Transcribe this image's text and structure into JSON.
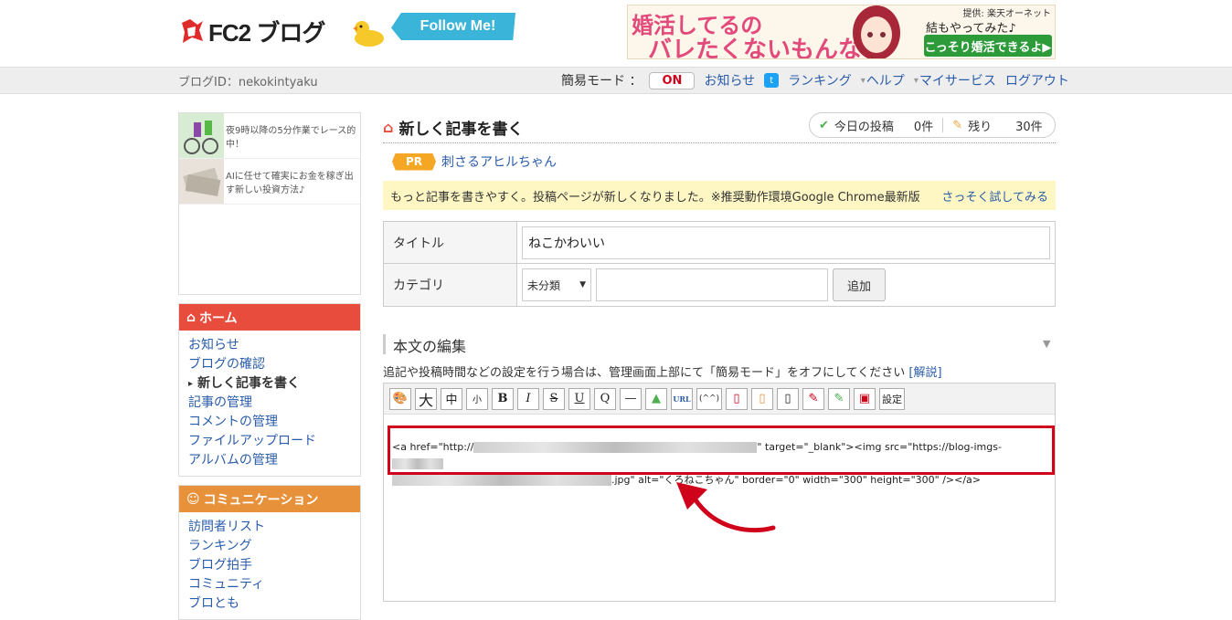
{
  "header": {
    "logo_text": "FC2 ブログ",
    "follow_label": "Follow Me!",
    "ad": {
      "headline1": "婚活してるの",
      "headline2": "バレたくないもんな",
      "provider": "提供: 楽天オーネット",
      "tagline": "結もやってみた♪",
      "button": "こっそり婚活できるよ▶"
    }
  },
  "navbar": {
    "blog_id": "ブログID：nekokintyaku",
    "mode_label": "簡易モード ：",
    "mode_toggle": "ON",
    "links": [
      "お知らせ",
      "ランキング",
      "ヘルプ",
      "マイサービス",
      "ログアウト"
    ]
  },
  "sidebar": {
    "ads": [
      {
        "text": "夜9時以降の5分作業でレース的中！"
      },
      {
        "text": "AIに任せて確実にお金を稼ぎ出す新しい投資方法♪"
      }
    ],
    "home": {
      "title": "ホーム",
      "items": [
        "お知らせ",
        "ブログの確認",
        "新しく記事を書く",
        "記事の管理",
        "コメントの管理",
        "ファイルアップロード",
        "アルバムの管理"
      ]
    },
    "communication": {
      "title": "コミュニケーション",
      "items": [
        "訪問者リスト",
        "ランキング",
        "ブログ拍手",
        "コミュニティ",
        "ブロとも"
      ]
    }
  },
  "main": {
    "page_title": "新しく記事を書く",
    "stats": {
      "today_label": "今日の投稿",
      "today_value": "0件",
      "remain_label": "残り",
      "remain_value": "30件"
    },
    "pr": {
      "tag": "PR",
      "link": "刺さるアヒルちゃん"
    },
    "notice": {
      "text": "もっと記事を書きやすく。投稿ページが新しくなりました。※推奨動作環境Google Chrome最新版",
      "link": "さっそく試してみる"
    },
    "form": {
      "title_label": "タイトル",
      "title_value": "ねこかわいい",
      "category_label": "カテゴリ",
      "category_selected": "未分類",
      "add_button": "追加"
    },
    "body": {
      "heading": "本文の編集",
      "note": "追記や投稿時間などの設定を行う場合は、管理画面上部にて「簡易モード」をオフにしてください",
      "note_link": "[解説]",
      "toolbar": [
        "🎨",
        "大",
        "中",
        "小",
        "B",
        "I",
        "S",
        "U",
        "Q",
        "—",
        "▲",
        "URL",
        "(^^)",
        "▯",
        "▯",
        "▯",
        "✎",
        "✎",
        "▣",
        "設定"
      ],
      "code_line1_a": "<a href=\"http://",
      "code_line1_b": "\" target=\"_blank\"><img src=\"https://blog-imgs-",
      "code_line2_a": ".jpg\" alt=\"くろねこちゃん\" border=\"0\" width=\"300\" height=\"300\" /></a>"
    }
  },
  "colors": {
    "accent": "#2a5caa",
    "home_header": "#e84c3d",
    "comm_header": "#e8913b",
    "highlight": "#d0021b"
  }
}
